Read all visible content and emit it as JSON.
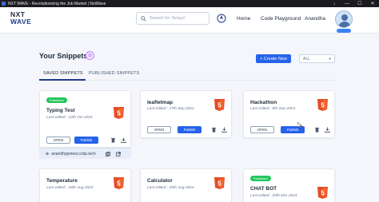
{
  "window": {
    "title": "NXT WAVE - Revolutionizing the Job Market | NxtWave",
    "controls": [
      "↓",
      "—",
      "☐",
      "✕"
    ]
  },
  "header": {
    "logo_line1": "NXT",
    "logo_line2": "WAVE",
    "search_placeholder": "Search for 'Arrays'",
    "nav_home": "Home",
    "nav_code_playground": "Code Playground",
    "user_name": "Anandha"
  },
  "page": {
    "title": "Your Snippets",
    "create_button": "+ Create New",
    "filter_value": "ALL",
    "tabs": [
      "SAVED SNIPPETS",
      "PUBLISHED SNIPPETS"
    ]
  },
  "cards": [
    {
      "name": "Typing Test",
      "badge": "Published",
      "edited": "Last edited : 12th Oct 2024",
      "open": "OPEN",
      "publish": "Publish",
      "link": "anandhypetest.ccbp.tech"
    },
    {
      "name": "leafletmap",
      "badge": "",
      "edited": "Last edited : 17th Sep 2024",
      "open": "OPEN",
      "publish": "Publish"
    },
    {
      "name": "Hackathon",
      "badge": "",
      "edited": "Last edited : 8th Sep 2024",
      "open": "OPEN",
      "publish": "Publish"
    },
    {
      "name": "Temperature",
      "badge": "",
      "edited": "Last edited : 26th Aug 2024"
    },
    {
      "name": "Calculator",
      "badge": "",
      "edited": "Last edited : 26th Aug 2024"
    },
    {
      "name": "CHAT BOT",
      "badge": "Published",
      "edited": "Last edited : 20th Mar 2024"
    }
  ],
  "icons": {
    "html5_label": "5"
  },
  "colors": {
    "primary": "#2563eb",
    "published_badge": "#22c55e",
    "html5_orange": "#e44d26"
  }
}
